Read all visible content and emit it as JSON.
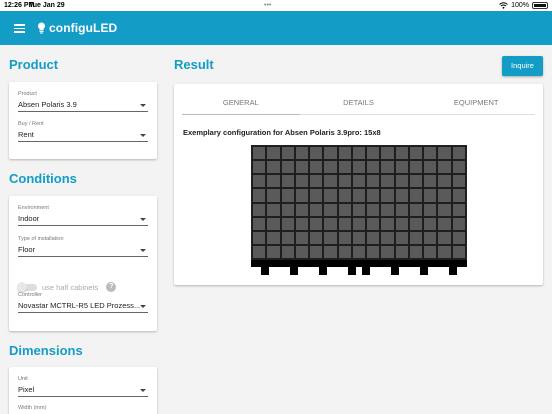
{
  "status": {
    "time": "12:26 PM",
    "date": "Tue Jan 29",
    "battery": "100%"
  },
  "appbar": {
    "title": "configuLED"
  },
  "product": {
    "title": "Product",
    "product_label": "Product",
    "product_value": "Absen Polaris 3.9",
    "buyrent_label": "Buy / Rent",
    "buyrent_value": "Rent"
  },
  "conditions": {
    "title": "Conditions",
    "environment_label": "Environment",
    "environment_value": "Indoor",
    "installation_label": "Type of installation",
    "installation_value": "Floor",
    "half_cabinets_label": "use half cabinets",
    "help_glyph": "?",
    "controller_label": "Controller",
    "controller_value": "Novastar MCTRL-R5 LED Prozess..."
  },
  "dimensions": {
    "title": "Dimensions",
    "unit_label": "Unit",
    "unit_value": "Pixel",
    "width_label": "Width (mm)"
  },
  "result": {
    "title": "Result",
    "inquire_label": "Inquire",
    "tabs": [
      "GENERAL",
      "DETAILS",
      "EQUIPMENT"
    ],
    "active_tab": "GENERAL",
    "config_text": "Exemplary configuration for Absen Polaris 3.9pro: 15x8",
    "grid": {
      "columns": 15,
      "rows": 8
    }
  },
  "colors": {
    "accent": "#139dc6",
    "cabinet": "#5a5a5a",
    "background": "#f3f3f3"
  },
  "icons": {
    "menu": "hamburger-menu-icon",
    "brand": "lightbulb-icon",
    "help": "help-icon"
  }
}
